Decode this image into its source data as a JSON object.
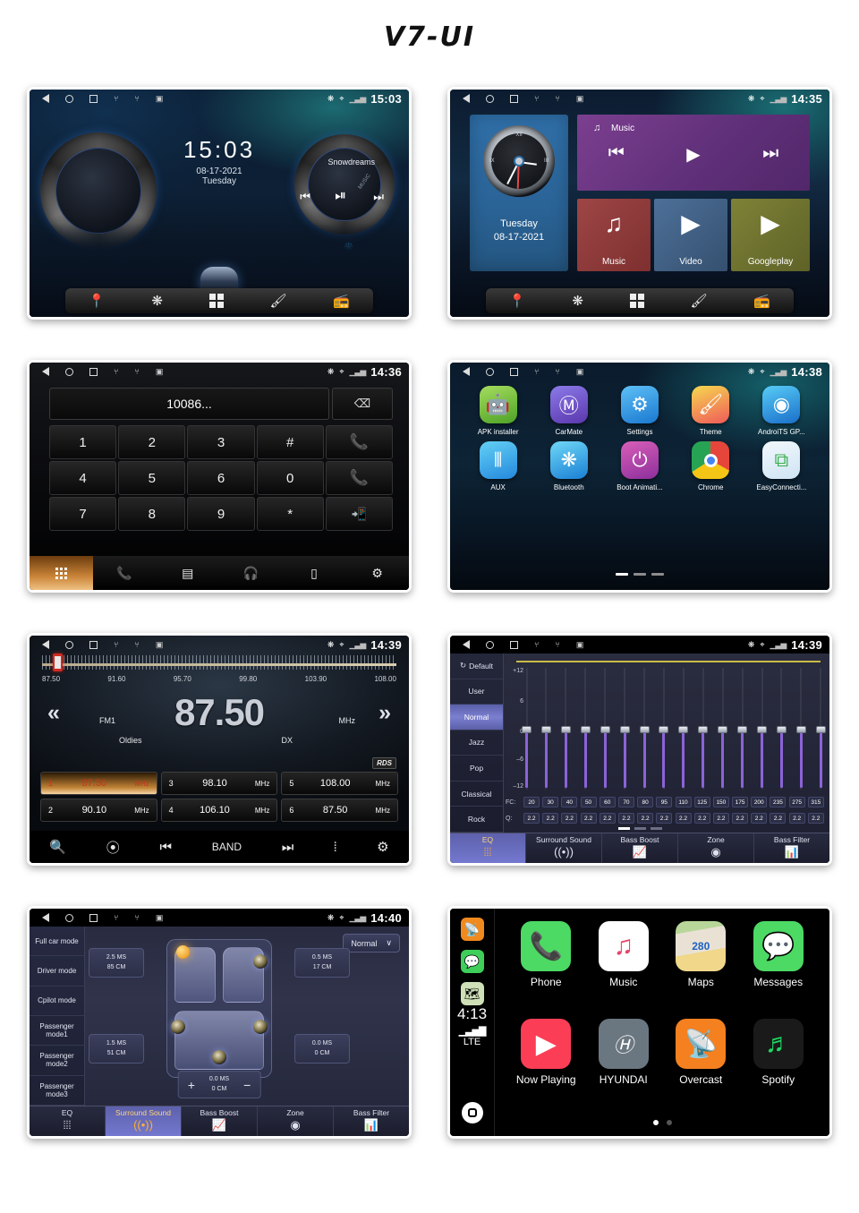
{
  "page": {
    "title": "V7-UI"
  },
  "screens": [
    {
      "id": "home-clock",
      "status": {
        "time": "15:03",
        "icons": [
          "back-icon",
          "home-icon",
          "recents-icon",
          "usb-icon",
          "usb-icon",
          "sdcard-icon",
          "bluetooth-icon",
          "location-icon",
          "signal-icon"
        ]
      },
      "clock": {
        "time": "15:03",
        "date": "08-17-2021",
        "weekday": "Tuesday"
      },
      "music": {
        "track": "Snowdreams",
        "label": "MUSIC",
        "prev": "⏮",
        "playpause": "⏯",
        "next": "⏭"
      },
      "dock": [
        "location-icon",
        "bluetooth-icon",
        "apps-icon",
        "theme-icon",
        "radio-icon"
      ]
    },
    {
      "id": "home-widgets",
      "status": {
        "time": "14:35"
      },
      "clock_widget": {
        "weekday": "Tuesday",
        "date": "08-17-2021",
        "numerals": [
          "XII",
          "III",
          "IX"
        ]
      },
      "music_widget": {
        "title": "Music",
        "prev": "⏮",
        "play": "▶",
        "next": "⏭"
      },
      "tiles": [
        {
          "label": "Music",
          "icon": "music-note-icon",
          "glyph": "♫",
          "color": "#8e3a3a"
        },
        {
          "label": "Video",
          "icon": "video-icon",
          "glyph": "▶",
          "color": "#3f648f"
        },
        {
          "label": "Googleplay",
          "icon": "google-play-icon",
          "glyph": "▶",
          "color": "#6f7330"
        }
      ],
      "dock": [
        "location-icon",
        "bluetooth-icon",
        "apps-icon",
        "theme-icon",
        "radio-icon"
      ]
    },
    {
      "id": "dialpad",
      "status": {
        "time": "14:36"
      },
      "display": {
        "value": "10086...",
        "delete_label": "⌫"
      },
      "keys": [
        "1",
        "2",
        "3",
        "#",
        "call",
        "4",
        "5",
        "6",
        "0",
        "hangup",
        "7",
        "8",
        "9",
        "*",
        "transfer"
      ],
      "key_glyphs": {
        "call": "✆",
        "hangup": "✆",
        "transfer": "↳"
      },
      "bottom_tabs": [
        "keypad-icon",
        "call-history-icon",
        "contacts-icon",
        "bt-headset-icon",
        "bt-phone-icon",
        "bt-settings-icon"
      ]
    },
    {
      "id": "apps",
      "status": {
        "time": "14:38"
      },
      "apps": [
        {
          "label": "APK installer",
          "icon": "android-icon",
          "glyph": "Ⓐ",
          "color1": "#8ed04a",
          "color2": "#5cb12c"
        },
        {
          "label": "CarMate",
          "icon": "carmate-icon",
          "glyph": "Ⓜ",
          "color1": "#7d6bd8",
          "color2": "#5f3fb8"
        },
        {
          "label": "Settings",
          "icon": "car-settings-icon",
          "glyph": "⚙",
          "color1": "#4fb4f0",
          "color2": "#1f86d8"
        },
        {
          "label": "Theme",
          "icon": "paintbrush-icon",
          "glyph": "✎",
          "color1": "#f7c948",
          "color2": "#ef5d5d"
        },
        {
          "label": "AndroiTS GP...",
          "icon": "gps-icon",
          "glyph": "◉",
          "color1": "#52c5f5",
          "color2": "#1f7fd0"
        },
        {
          "label": "AUX",
          "icon": "aux-icon",
          "glyph": "‖",
          "color1": "#59c8f2",
          "color2": "#2a8fe0"
        },
        {
          "label": "Bluetooth",
          "icon": "bluetooth-icon",
          "glyph": "ᛗ",
          "color1": "#5fd0f5",
          "color2": "#1f86d8"
        },
        {
          "label": "Boot Animati...",
          "icon": "power-icon",
          "glyph": "⏻",
          "color1": "#d24bb0",
          "color2": "#8b2f9e"
        },
        {
          "label": "Chrome",
          "icon": "chrome-icon",
          "glyph": "●",
          "color1": "#f2f2f2",
          "color2": "#d8d8d8"
        },
        {
          "label": "EasyConnecti...",
          "icon": "easyconnect-icon",
          "glyph": "⧉",
          "color1": "#eaf4fb",
          "color2": "#cfe5f5"
        }
      ],
      "page_dots": 3,
      "active_dot": 0
    },
    {
      "id": "radio",
      "status": {
        "time": "14:39"
      },
      "tuner": {
        "scale": [
          "87.50",
          "91.60",
          "95.70",
          "99.80",
          "103.90",
          "108.00"
        ]
      },
      "current": {
        "frequency": "87.50",
        "unit": "MHz",
        "band": "FM1",
        "genre": "Oldies",
        "mode": "DX",
        "rds": "RDS"
      },
      "presets": [
        {
          "num": "1",
          "freq": "87.50",
          "unit": "MHz",
          "selected": true
        },
        {
          "num": "3",
          "freq": "98.10",
          "unit": "MHz",
          "selected": false
        },
        {
          "num": "5",
          "freq": "108.00",
          "unit": "MHz",
          "selected": false
        },
        {
          "num": "2",
          "freq": "90.10",
          "unit": "MHz",
          "selected": false
        },
        {
          "num": "4",
          "freq": "106.10",
          "unit": "MHz",
          "selected": false
        },
        {
          "num": "6",
          "freq": "87.50",
          "unit": "MHz",
          "selected": false
        }
      ],
      "bottom": {
        "band_label": "BAND",
        "icons": [
          "search-icon",
          "antenna-icon",
          "prev-icon",
          "next-icon",
          "equalizer-icon",
          "settings-icon"
        ]
      },
      "nav": {
        "prev": "«",
        "next": "»"
      }
    },
    {
      "id": "equalizer",
      "status": {
        "time": "14:39"
      },
      "presets": [
        "Default",
        "User",
        "Normal",
        "Jazz",
        "Pop",
        "Classical",
        "Rock"
      ],
      "active_preset": "Normal",
      "axis": [
        "+12",
        "6",
        "0",
        "–6",
        "–12"
      ],
      "fc_label": "FC:",
      "q_label": "Q:",
      "fc_values": [
        "20",
        "30",
        "40",
        "50",
        "60",
        "70",
        "80",
        "95",
        "110",
        "125",
        "150",
        "175",
        "200",
        "235",
        "275",
        "315"
      ],
      "q_values": [
        "2.2",
        "2.2",
        "2.2",
        "2.2",
        "2.2",
        "2.2",
        "2.2",
        "2.2",
        "2.2",
        "2.2",
        "2.2",
        "2.2",
        "2.2",
        "2.2",
        "2.2",
        "2.2"
      ],
      "tabs": [
        {
          "label": "EQ",
          "icon": "equalizer-icon",
          "glyph": "⦀",
          "active": true
        },
        {
          "label": "Surround Sound",
          "icon": "surround-icon",
          "glyph": "((•))",
          "active": false
        },
        {
          "label": "Bass Boost",
          "icon": "bass-boost-icon",
          "glyph": "Ὄ8",
          "active": false
        },
        {
          "label": "Zone",
          "icon": "zone-icon",
          "glyph": "◉",
          "active": false
        },
        {
          "label": "Bass Filter",
          "icon": "bass-filter-icon",
          "glyph": "ὌA",
          "active": false
        }
      ],
      "page_dots": 3,
      "active_dot": 0
    },
    {
      "id": "surround-sound",
      "status": {
        "time": "14:40"
      },
      "modes": [
        "Full car mode",
        "Driver mode",
        "Cpilot mode",
        "Passenger mode1",
        "Passenger mode2",
        "Passenger mode3"
      ],
      "dropdown": {
        "value": "Normal",
        "chevron": "∨"
      },
      "delays": [
        {
          "position": "front-left",
          "ms": "2.5 MS",
          "cm": "85 CM"
        },
        {
          "position": "front-right",
          "ms": "0.5 MS",
          "cm": "17 CM"
        },
        {
          "position": "rear-left",
          "ms": "1.5 MS",
          "cm": "51 CM"
        },
        {
          "position": "rear-right",
          "ms": "0.0 MS",
          "cm": "0 CM"
        }
      ],
      "stepper": {
        "plus": "+",
        "minus": "−",
        "ms": "0.0 MS",
        "cm": "0 CM"
      },
      "tabs": [
        {
          "label": "EQ",
          "icon": "equalizer-icon",
          "glyph": "⦀",
          "active": false
        },
        {
          "label": "Surround Sound",
          "icon": "surround-icon",
          "glyph": "((•))",
          "active": true
        },
        {
          "label": "Bass Boost",
          "icon": "bass-boost-icon",
          "glyph": "Ὄ8",
          "active": false
        },
        {
          "label": "Zone",
          "icon": "zone-icon",
          "glyph": "◉",
          "active": false
        },
        {
          "label": "Bass Filter",
          "icon": "bass-filter-icon",
          "glyph": "ὌA",
          "active": false
        }
      ]
    },
    {
      "id": "carplay",
      "sidebar": {
        "minis": [
          {
            "icon": "overcast-icon",
            "glyph": "὎1",
            "color": "#f08a1e"
          },
          {
            "icon": "messages-icon",
            "glyph": "ὊC",
            "color": "#3ecf5a"
          },
          {
            "icon": "maps-icon",
            "glyph": "ὟA",
            "color": "#cfe0b8"
          }
        ],
        "time": "4:13",
        "signal": "▁▃▅▇",
        "network": "LTE",
        "home_icon": "home-icon"
      },
      "apps": [
        {
          "label": "Phone",
          "icon": "phone-icon",
          "glyph": "✆",
          "color": "#4cd964"
        },
        {
          "label": "Music",
          "icon": "apple-music-icon",
          "glyph": "♫",
          "color": "#ffffff"
        },
        {
          "label": "Maps",
          "icon": "maps-icon",
          "glyph": "280",
          "color": "#dce8cd"
        },
        {
          "label": "Messages",
          "icon": "messages-icon",
          "glyph": "ὊC",
          "color": "#4cd964"
        },
        {
          "label": "Now Playing",
          "icon": "now-playing-icon",
          "glyph": "▶",
          "color": "#fc3d56"
        },
        {
          "label": "HYUNDAI",
          "icon": "hyundai-icon",
          "glyph": "Ⓗ",
          "color": "#6b7780"
        },
        {
          "label": "Overcast",
          "icon": "overcast-icon",
          "glyph": "὎1",
          "color": "#f48020"
        },
        {
          "label": "Spotify",
          "icon": "spotify-icon",
          "glyph": "♬",
          "color": "#1a1a1a"
        }
      ],
      "page_dots": 2,
      "active_dot": 0
    }
  ]
}
